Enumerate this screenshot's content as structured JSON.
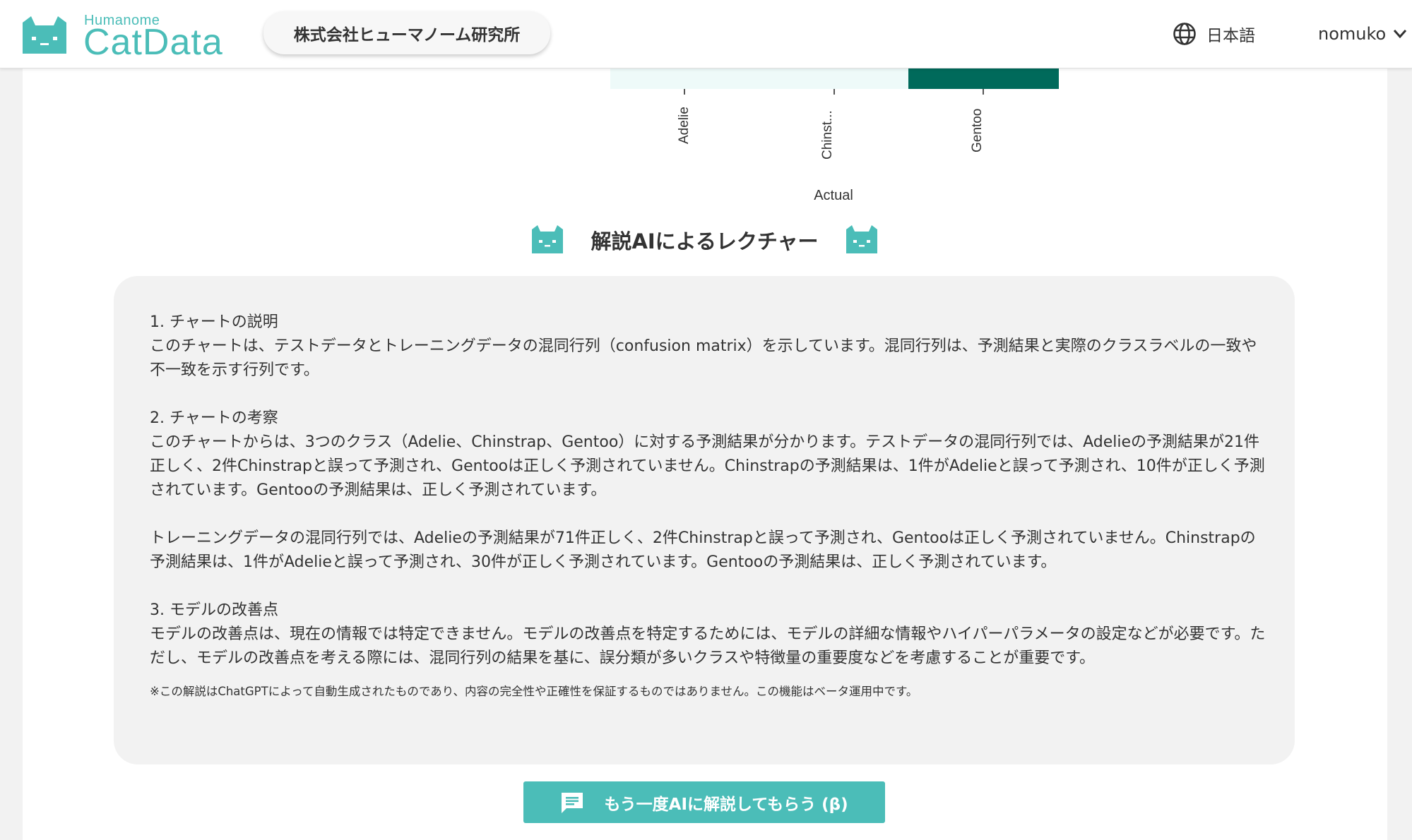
{
  "header": {
    "logo_sub": "Humanome",
    "logo_main": "CatData",
    "company": "株式会社ヒューマノーム研究所",
    "language": "日本語",
    "user": "nomuko"
  },
  "chart_data": {
    "type": "heatmap",
    "x_categories": [
      "Adelie",
      "Chinst...",
      "Gentoo"
    ],
    "xlabel": "Actual",
    "visible_row_colors": [
      "#eefaf9",
      "#eefaf9",
      "#006a5b"
    ]
  },
  "lecture": {
    "title": "解説AIによるレクチャー",
    "s1_heading": "1. チャートの説明",
    "s1_body": "このチャートは、テストデータとトレーニングデータの混同行列（confusion matrix）を示しています。混同行列は、予測結果と実際のクラスラベルの一致や不一致を示す行列です。",
    "s2_heading": "2. チャートの考察",
    "s2_body": "このチャートからは、3つのクラス（Adelie、Chinstrap、Gentoo）に対する予測結果が分かります。テストデータの混同行列では、Adelieの予測結果が21件正しく、2件Chinstrapと誤って予測され、Gentooは正しく予測されていません。Chinstrapの予測結果は、1件がAdelieと誤って予測され、10件が正しく予測されています。Gentooの予測結果は、正しく予測されています。",
    "s2_body2": "トレーニングデータの混同行列では、Adelieの予測結果が71件正しく、2件Chinstrapと誤って予測され、Gentooは正しく予測されていません。Chinstrapの予測結果は、1件がAdelieと誤って予測され、30件が正しく予測されています。Gentooの予測結果は、正しく予測されています。",
    "s3_heading": "3. モデルの改善点",
    "s3_body": "モデルの改善点は、現在の情報では特定できません。モデルの改善点を特定するためには、モデルの詳細な情報やハイパーパラメータの設定などが必要です。ただし、モデルの改善点を考える際には、混同行列の結果を基に、誤分類が多いクラスや特徴量の重要度などを考慮することが重要です。",
    "note": "※この解説はChatGPTによって自動生成されたものであり、内容の完全性や正確性を保証するものではありません。この機能はベータ運用中です。"
  },
  "cta": {
    "label": "もう一度AIに解説してもらう (β)"
  },
  "colors": {
    "accent": "#4bbdb8",
    "dark_cell": "#006a5b",
    "light_cell": "#eefaf9"
  }
}
